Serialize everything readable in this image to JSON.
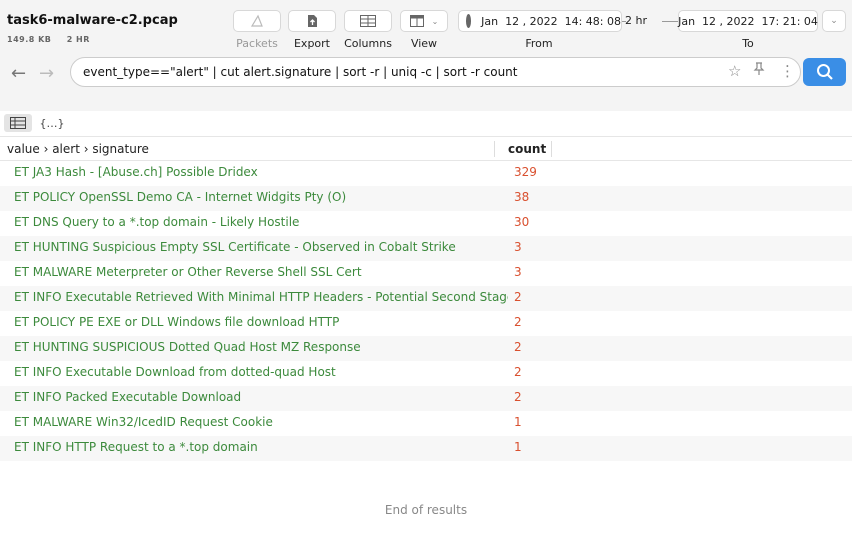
{
  "file": {
    "title": "task6-malware-c2.pcap",
    "size": "149.8 KB",
    "duration": "2 HR"
  },
  "toolbar": {
    "packets_label": "Packets",
    "export_label": "Export",
    "columns_label": "Columns",
    "view_label": "View"
  },
  "time": {
    "from_value": "Jan  12 , 2022  14: 48: 08",
    "from_label": "From",
    "span": "2 hr",
    "to_value": "Jan  12 , 2022  17: 21: 04",
    "to_label": "To"
  },
  "search": {
    "query": "event_type==\"alert\" | cut alert.signature | sort -r | uniq -c | sort -r count"
  },
  "view_tabs": {
    "table": "▤",
    "json": "{…}"
  },
  "table": {
    "col1": "value › alert › signature",
    "col2": "count",
    "rows": [
      {
        "signature": "ET JA3 Hash - [Abuse.ch] Possible Dridex",
        "count": "329"
      },
      {
        "signature": "ET POLICY OpenSSL Demo CA - Internet Widgits Pty (O)",
        "count": "38"
      },
      {
        "signature": "ET DNS Query to a *.top domain - Likely Hostile",
        "count": "30"
      },
      {
        "signature": "ET HUNTING Suspicious Empty SSL Certificate - Observed in Cobalt Strike",
        "count": "3"
      },
      {
        "signature": "ET MALWARE Meterpreter or Other Reverse Shell SSL Cert",
        "count": "3"
      },
      {
        "signature": "ET INFO Executable Retrieved With Minimal HTTP Headers - Potential Second Stage",
        "count": "2"
      },
      {
        "signature": "ET POLICY PE EXE or DLL Windows file download HTTP",
        "count": "2"
      },
      {
        "signature": "ET HUNTING SUSPICIOUS Dotted Quad Host MZ Response",
        "count": "2"
      },
      {
        "signature": "ET INFO Executable Download from dotted-quad Host",
        "count": "2"
      },
      {
        "signature": "ET INFO Packed Executable Download",
        "count": "2"
      },
      {
        "signature": "ET MALWARE Win32/IcedID Request Cookie",
        "count": "1"
      },
      {
        "signature": "ET INFO HTTP Request to a *.top domain",
        "count": "1"
      }
    ]
  },
  "footer": {
    "end_text": "End of results"
  },
  "colors": {
    "accent": "#3a8ee6",
    "signature": "#3c8a3c",
    "count": "#d9502f"
  }
}
